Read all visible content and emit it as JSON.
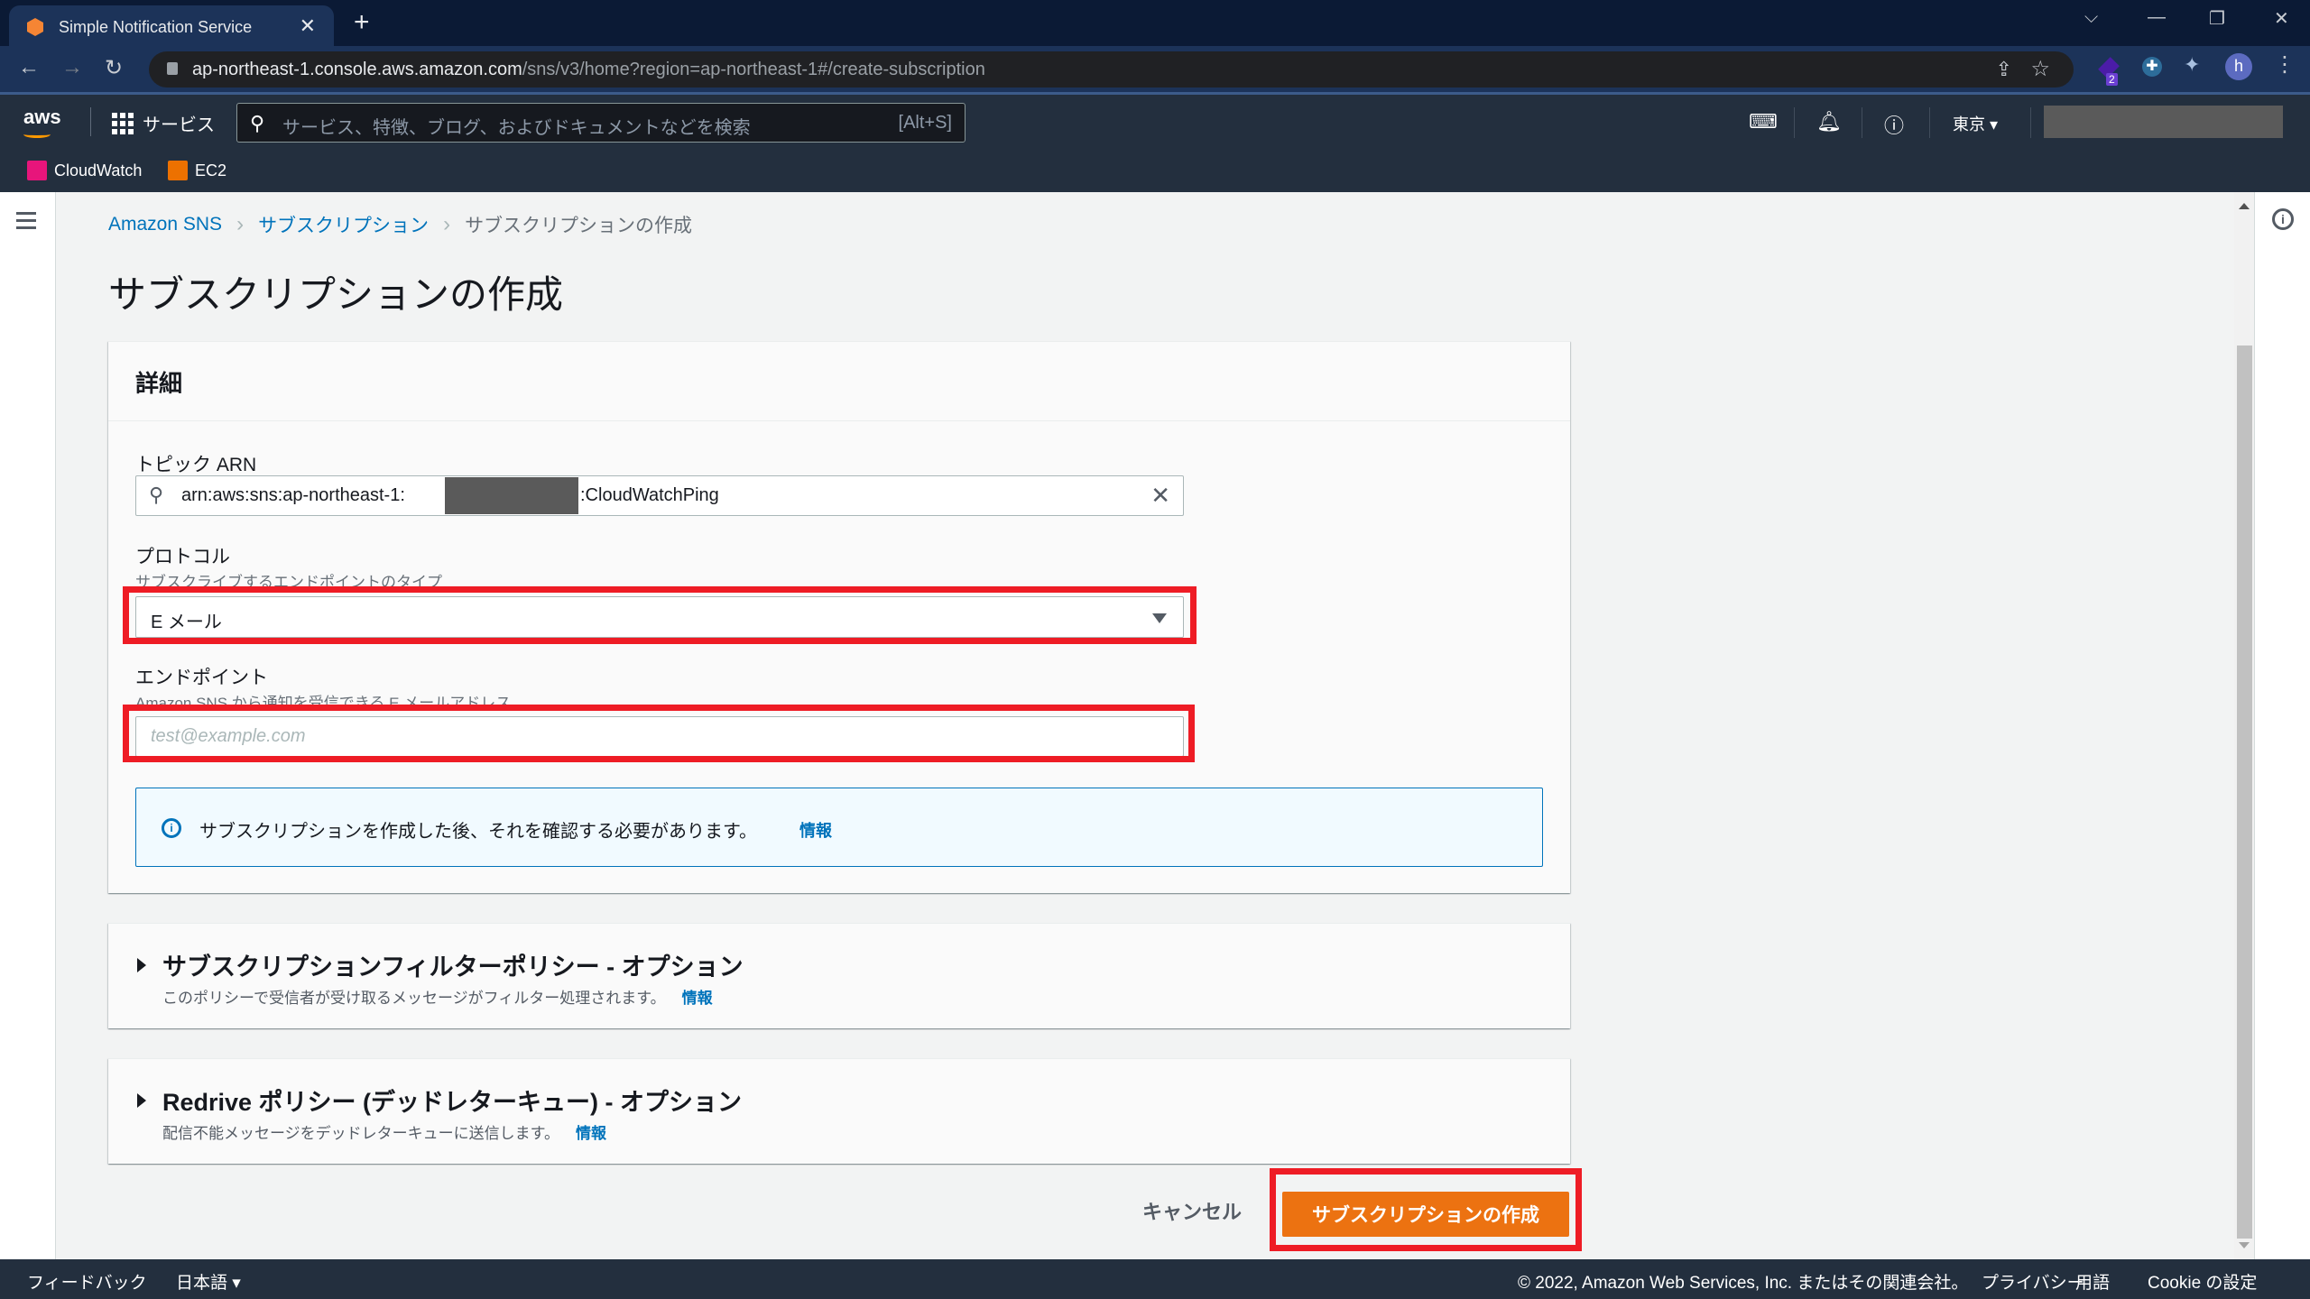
{
  "browser": {
    "tab_title": "Simple Notification Service",
    "url_host": "ap-northeast-1.console.aws.amazon.com",
    "url_path": "/sns/v3/home?region=ap-northeast-1#/create-subscription",
    "profile_initial": "h",
    "extension_badge": "2"
  },
  "awsnav": {
    "logo": "aws",
    "services_label": "サービス",
    "search_placeholder": "サービス、特徴、ブログ、およびドキュメントなどを検索",
    "search_shortcut": "[Alt+S]",
    "region_label": "東京 ▾"
  },
  "bookmarks": [
    {
      "label": "CloudWatch",
      "color": "#e7157b"
    },
    {
      "label": "EC2",
      "color": "#ed7100"
    }
  ],
  "breadcrumb": {
    "items": [
      "Amazon SNS",
      "サブスクリプション",
      "サブスクリプションの作成"
    ]
  },
  "page": {
    "title": "サブスクリプションの作成"
  },
  "details": {
    "heading": "詳細",
    "topic_arn": {
      "label": "トピック ARN",
      "value_prefix": "arn:aws:sns:ap-northeast-1:",
      "value_suffix": ":CloudWatchPing"
    },
    "protocol": {
      "label": "プロトコル",
      "description": "サブスクライブするエンドポイントのタイプ",
      "selected": "E メール"
    },
    "endpoint": {
      "label": "エンドポイント",
      "description": "Amazon SNS から通知を受信できる E メールアドレス。",
      "value": "",
      "placeholder": "test@example.com"
    },
    "alert": {
      "message": "サブスクリプションを作成した後、それを確認する必要があります。",
      "info_link": "情報"
    }
  },
  "filter_policy": {
    "title": "サブスクリプションフィルターポリシー - オプション",
    "description": "このポリシーで受信者が受け取るメッセージがフィルター処理されます。",
    "info_link": "情報",
    "expanded": false
  },
  "redrive_policy": {
    "title": "Redrive ポリシー (デッドレターキュー) - オプション",
    "description": "配信不能メッセージをデッドレターキューに送信します。",
    "info_link": "情報",
    "expanded": false
  },
  "actions": {
    "cancel_label": "キャンセル",
    "create_label": "サブスクリプションの作成",
    "primary_color": "#ec7211"
  },
  "footer": {
    "feedback": "フィードバック",
    "language": "日本語 ▾",
    "copyright": "© 2022, Amazon Web Services, Inc. またはその関連会社。",
    "privacy": "プライバシー",
    "terms": "用語",
    "cookie": "Cookie の設定"
  },
  "annotation_color": "#ee1c25"
}
